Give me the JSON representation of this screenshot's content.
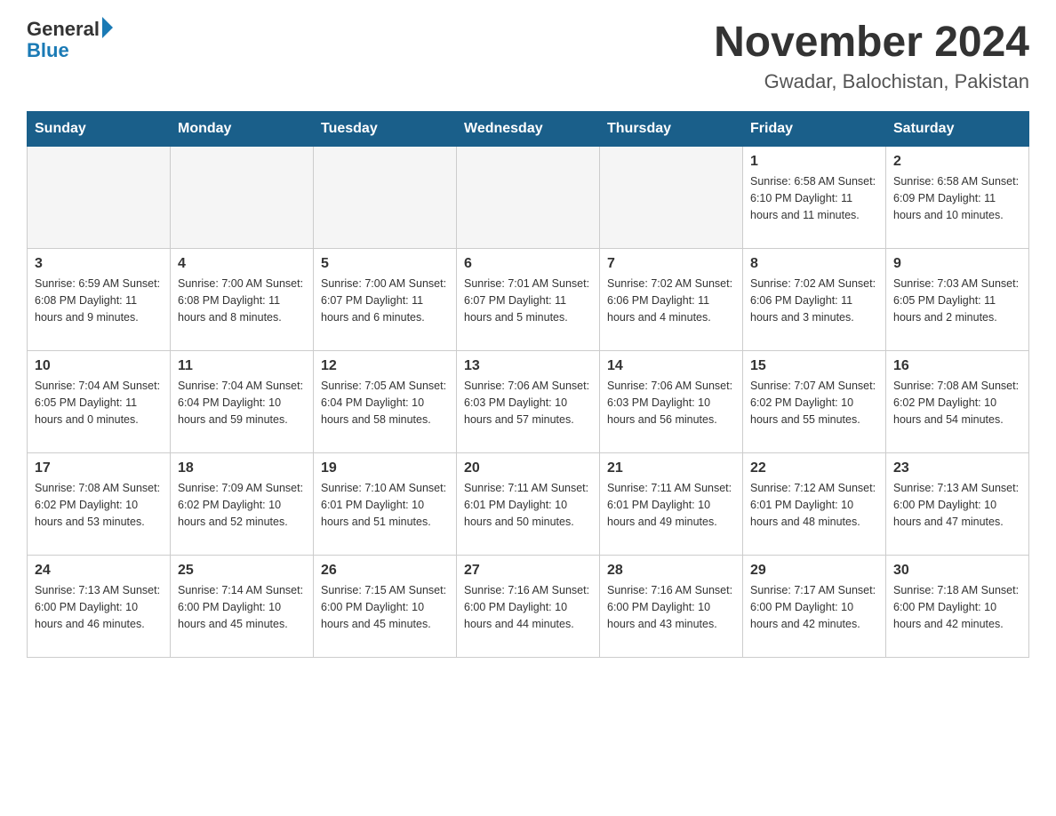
{
  "logo": {
    "general": "General",
    "blue": "Blue"
  },
  "header": {
    "title": "November 2024",
    "subtitle": "Gwadar, Balochistan, Pakistan"
  },
  "days_of_week": [
    "Sunday",
    "Monday",
    "Tuesday",
    "Wednesday",
    "Thursday",
    "Friday",
    "Saturday"
  ],
  "weeks": [
    [
      {
        "day": "",
        "info": ""
      },
      {
        "day": "",
        "info": ""
      },
      {
        "day": "",
        "info": ""
      },
      {
        "day": "",
        "info": ""
      },
      {
        "day": "",
        "info": ""
      },
      {
        "day": "1",
        "info": "Sunrise: 6:58 AM\nSunset: 6:10 PM\nDaylight: 11 hours and 11 minutes."
      },
      {
        "day": "2",
        "info": "Sunrise: 6:58 AM\nSunset: 6:09 PM\nDaylight: 11 hours and 10 minutes."
      }
    ],
    [
      {
        "day": "3",
        "info": "Sunrise: 6:59 AM\nSunset: 6:08 PM\nDaylight: 11 hours and 9 minutes."
      },
      {
        "day": "4",
        "info": "Sunrise: 7:00 AM\nSunset: 6:08 PM\nDaylight: 11 hours and 8 minutes."
      },
      {
        "day": "5",
        "info": "Sunrise: 7:00 AM\nSunset: 6:07 PM\nDaylight: 11 hours and 6 minutes."
      },
      {
        "day": "6",
        "info": "Sunrise: 7:01 AM\nSunset: 6:07 PM\nDaylight: 11 hours and 5 minutes."
      },
      {
        "day": "7",
        "info": "Sunrise: 7:02 AM\nSunset: 6:06 PM\nDaylight: 11 hours and 4 minutes."
      },
      {
        "day": "8",
        "info": "Sunrise: 7:02 AM\nSunset: 6:06 PM\nDaylight: 11 hours and 3 minutes."
      },
      {
        "day": "9",
        "info": "Sunrise: 7:03 AM\nSunset: 6:05 PM\nDaylight: 11 hours and 2 minutes."
      }
    ],
    [
      {
        "day": "10",
        "info": "Sunrise: 7:04 AM\nSunset: 6:05 PM\nDaylight: 11 hours and 0 minutes."
      },
      {
        "day": "11",
        "info": "Sunrise: 7:04 AM\nSunset: 6:04 PM\nDaylight: 10 hours and 59 minutes."
      },
      {
        "day": "12",
        "info": "Sunrise: 7:05 AM\nSunset: 6:04 PM\nDaylight: 10 hours and 58 minutes."
      },
      {
        "day": "13",
        "info": "Sunrise: 7:06 AM\nSunset: 6:03 PM\nDaylight: 10 hours and 57 minutes."
      },
      {
        "day": "14",
        "info": "Sunrise: 7:06 AM\nSunset: 6:03 PM\nDaylight: 10 hours and 56 minutes."
      },
      {
        "day": "15",
        "info": "Sunrise: 7:07 AM\nSunset: 6:02 PM\nDaylight: 10 hours and 55 minutes."
      },
      {
        "day": "16",
        "info": "Sunrise: 7:08 AM\nSunset: 6:02 PM\nDaylight: 10 hours and 54 minutes."
      }
    ],
    [
      {
        "day": "17",
        "info": "Sunrise: 7:08 AM\nSunset: 6:02 PM\nDaylight: 10 hours and 53 minutes."
      },
      {
        "day": "18",
        "info": "Sunrise: 7:09 AM\nSunset: 6:02 PM\nDaylight: 10 hours and 52 minutes."
      },
      {
        "day": "19",
        "info": "Sunrise: 7:10 AM\nSunset: 6:01 PM\nDaylight: 10 hours and 51 minutes."
      },
      {
        "day": "20",
        "info": "Sunrise: 7:11 AM\nSunset: 6:01 PM\nDaylight: 10 hours and 50 minutes."
      },
      {
        "day": "21",
        "info": "Sunrise: 7:11 AM\nSunset: 6:01 PM\nDaylight: 10 hours and 49 minutes."
      },
      {
        "day": "22",
        "info": "Sunrise: 7:12 AM\nSunset: 6:01 PM\nDaylight: 10 hours and 48 minutes."
      },
      {
        "day": "23",
        "info": "Sunrise: 7:13 AM\nSunset: 6:00 PM\nDaylight: 10 hours and 47 minutes."
      }
    ],
    [
      {
        "day": "24",
        "info": "Sunrise: 7:13 AM\nSunset: 6:00 PM\nDaylight: 10 hours and 46 minutes."
      },
      {
        "day": "25",
        "info": "Sunrise: 7:14 AM\nSunset: 6:00 PM\nDaylight: 10 hours and 45 minutes."
      },
      {
        "day": "26",
        "info": "Sunrise: 7:15 AM\nSunset: 6:00 PM\nDaylight: 10 hours and 45 minutes."
      },
      {
        "day": "27",
        "info": "Sunrise: 7:16 AM\nSunset: 6:00 PM\nDaylight: 10 hours and 44 minutes."
      },
      {
        "day": "28",
        "info": "Sunrise: 7:16 AM\nSunset: 6:00 PM\nDaylight: 10 hours and 43 minutes."
      },
      {
        "day": "29",
        "info": "Sunrise: 7:17 AM\nSunset: 6:00 PM\nDaylight: 10 hours and 42 minutes."
      },
      {
        "day": "30",
        "info": "Sunrise: 7:18 AM\nSunset: 6:00 PM\nDaylight: 10 hours and 42 minutes."
      }
    ]
  ]
}
